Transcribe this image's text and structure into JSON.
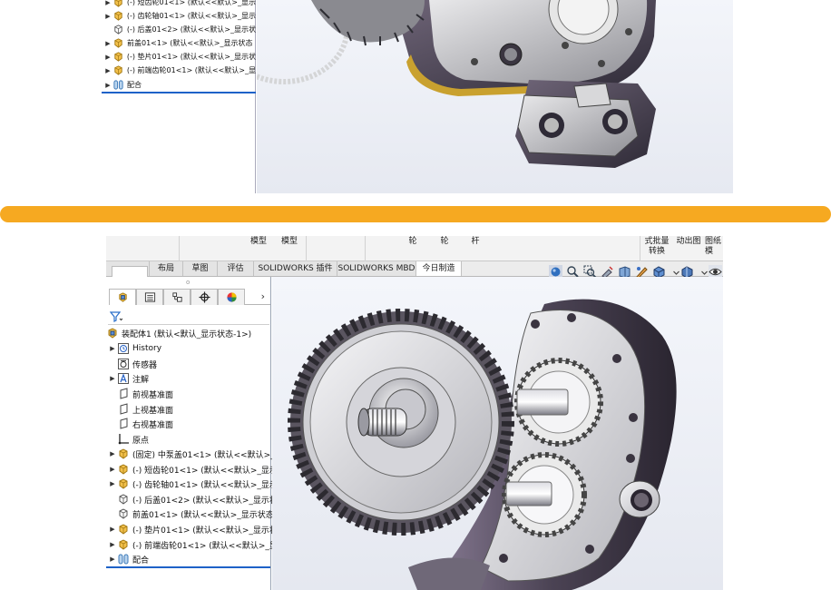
{
  "top_panel": {
    "tree_items": [
      {
        "label": "(-) 短齿轮01<1> (默认<<默认>_显示",
        "icon": "part-icon",
        "expand": true
      },
      {
        "label": "(-) 齿轮轴01<1> (默认<<默认>_显示",
        "icon": "part-icon",
        "expand": true
      },
      {
        "label": "(-) 后盖01<2> (默认<<默认>_显示状",
        "icon": "part-outline-icon",
        "expand": false
      },
      {
        "label": "前盖01<1> (默认<<默认>_显示状态",
        "icon": "part-icon",
        "expand": true
      },
      {
        "label": "(-) 垫片01<1> (默认<<默认>_显示状",
        "icon": "part-icon",
        "expand": true
      },
      {
        "label": "(-) 前端齿轮01<1> (默认<<默认>_显",
        "icon": "part-icon",
        "expand": true
      },
      {
        "label": "配合",
        "icon": "mates-icon",
        "expand": true
      }
    ]
  },
  "divider_color": "#f6a921",
  "ribbon": {
    "labels": [
      "模型",
      "模型",
      "轮",
      "轮",
      "杆",
      "式批量\n转换",
      "动出图",
      "图纸\n模"
    ]
  },
  "tabs": [
    {
      "label": "布局",
      "active": false
    },
    {
      "label": "草图",
      "active": false
    },
    {
      "label": "评估",
      "active": false
    },
    {
      "label": "SOLIDWORKS 插件",
      "active": false
    },
    {
      "label": "SOLIDWORKS MBD",
      "active": false
    },
    {
      "label": "今日制造",
      "active": true
    }
  ],
  "heads_up_icons": [
    "view-sphere-icon",
    "zoom-fit-icon",
    "zoom-area-icon",
    "previous-view-icon",
    "section-view-icon",
    "dynamic-annotation-icon",
    "view-orientation-icon",
    "display-style-icon",
    "hide-show-icon",
    "appearance-icon"
  ],
  "feature_manager": {
    "tab_icons": [
      "assembly-icon",
      "property-manager-icon",
      "configuration-manager-icon",
      "dimxpert-icon",
      "display-manager-icon"
    ],
    "root": "装配体1 (默认<默认_显示状态-1>)",
    "items": [
      {
        "label": "History",
        "icon": "history-icon",
        "expand": true
      },
      {
        "label": "传感器",
        "icon": "sensor-icon",
        "expand": false
      },
      {
        "label": "注解",
        "icon": "annotation-icon",
        "expand": true
      },
      {
        "label": "前视基准面",
        "icon": "plane-icon",
        "expand": false
      },
      {
        "label": "上视基准面",
        "icon": "plane-icon",
        "expand": false
      },
      {
        "label": "右视基准面",
        "icon": "plane-icon",
        "expand": false
      },
      {
        "label": "原点",
        "icon": "origin-icon",
        "expand": false
      },
      {
        "label": "(固定) 中泵盖01<1> (默认<<默认>_显",
        "icon": "part-icon",
        "expand": true
      },
      {
        "label": "(-) 短齿轮01<1> (默认<<默认>_显示",
        "icon": "part-icon",
        "expand": true
      },
      {
        "label": "(-) 齿轮轴01<1> (默认<<默认>_显示",
        "icon": "part-icon",
        "expand": true
      },
      {
        "label": "(-) 后盖01<2> (默认<<默认>_显示状",
        "icon": "part-outline-icon",
        "expand": false
      },
      {
        "label": "前盖01<1> (默认<<默认>_显示状态",
        "icon": "part-outline-icon",
        "expand": false
      },
      {
        "label": "(-) 垫片01<1> (默认<<默认>_显示状",
        "icon": "part-icon",
        "expand": true
      },
      {
        "label": "(-) 前端齿轮01<1> (默认<<默认>_显",
        "icon": "part-icon",
        "expand": true
      },
      {
        "label": "配合",
        "icon": "mates-icon",
        "expand": true
      }
    ]
  }
}
